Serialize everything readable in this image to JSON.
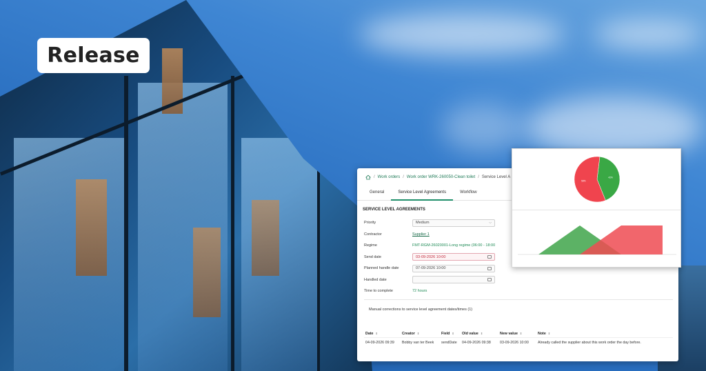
{
  "badge": {
    "label": "Release"
  },
  "breadcrumb": {
    "items": [
      "Work orders",
      "Work order WRK-260050-Clean toilet",
      "Service Level A"
    ]
  },
  "tabs": [
    "General",
    "Service Level Agreements",
    "Workflow"
  ],
  "active_tab": "Service Level Agreements",
  "section_title": "SERVICE LEVEL AGREEMENTS",
  "fields": {
    "priority": {
      "label": "Priority",
      "value": "Medium"
    },
    "contractor": {
      "label": "Contractor",
      "value": "Supplier 1"
    },
    "regime": {
      "label": "Regime",
      "value": "FMT-RGM-26020001-Long regime (06:00 - 18:00"
    },
    "send_date": {
      "label": "Send date",
      "value": "03-09-2026 10:00"
    },
    "planned_handle_date": {
      "label": "Planned handle date",
      "value": "07-09-2026 10:00"
    },
    "handled_date": {
      "label": "Handled date",
      "value": ""
    },
    "time_to_complete": {
      "label": "Time to complete",
      "value": "72 hours"
    }
  },
  "corrections": {
    "title": "Manual corrections to service level agreement dates/times (1)",
    "columns": [
      "Date",
      "Creator",
      "Field",
      "Old value",
      "New value",
      "Note"
    ],
    "rows": [
      [
        "04-09-2026 09:39",
        "Bobby van ter Beek",
        "sendDate",
        "04-09-2026 09:38",
        "03-09-2026 10:00",
        "Already called the supplier about this work order the day before."
      ]
    ]
  },
  "colors": {
    "accent": "#1f8f6a",
    "pie_green": "#3aa845",
    "pie_red": "#f0444e",
    "area_green": "#3fa54a",
    "area_red": "#ee4b52"
  },
  "chart_data": [
    {
      "type": "pie",
      "slices": [
        {
          "value": 0.42,
          "color": "#3aa845",
          "label": "42%"
        },
        {
          "value": 0.58,
          "color": "#f0444e",
          "label": "58%"
        }
      ]
    },
    {
      "type": "area",
      "categories": [
        "",
        "",
        "",
        ""
      ],
      "series": [
        {
          "values": [
            0,
            1,
            0,
            0
          ],
          "color": "#3fa54a"
        },
        {
          "values": [
            0,
            0,
            1,
            1
          ],
          "color": "#ee4b52"
        }
      ],
      "ylim": [
        0,
        1
      ]
    }
  ]
}
